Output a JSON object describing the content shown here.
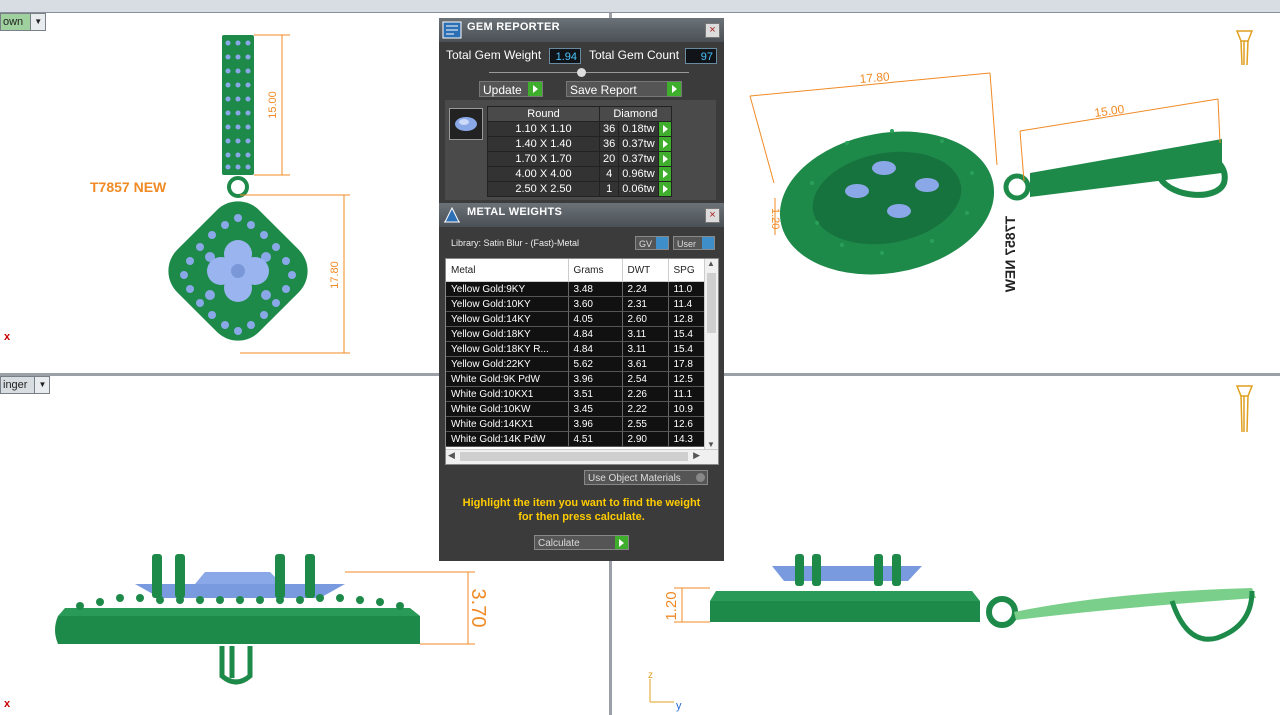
{
  "viewports": {
    "top_left_label": "own",
    "bottom_left_label": "inger"
  },
  "annotations": {
    "model_name": "T7857 NEW",
    "model_name_mirrored": "T7857 NEW",
    "dim_bail_length": "15.00",
    "dim_pendant_height": "17.80",
    "dim_side_height": "3.70",
    "dim_small_height": "1.20",
    "dim_persp_width": "17.80",
    "dim_persp_bail": "15.00",
    "dim_persp_small": "1.20",
    "axis_z": "z",
    "axis_y": "y",
    "red_mark": "x"
  },
  "gem_reporter": {
    "title": "GEM REPORTER",
    "total_weight_label": "Total Gem Weight",
    "total_weight_value": "1.94",
    "total_count_label": "Total Gem Count",
    "total_count_value": "97",
    "update_label": "Update",
    "save_label": "Save Report",
    "shape_header": "Round",
    "material_header": "Diamond",
    "rows": [
      {
        "size": "1.10 X 1.10",
        "count": "36",
        "weight": "0.18tw"
      },
      {
        "size": "1.40 X 1.40",
        "count": "36",
        "weight": "0.37tw"
      },
      {
        "size": "1.70 X 1.70",
        "count": "20",
        "weight": "0.37tw"
      },
      {
        "size": "4.00 X 4.00",
        "count": "4",
        "weight": "0.96tw"
      },
      {
        "size": "2.50 X 2.50",
        "count": "1",
        "weight": "0.06tw"
      }
    ]
  },
  "metal_weights": {
    "title": "METAL WEIGHTS",
    "library": "Library: Satin Blur - (Fast)-Metal",
    "toggle_gv": "GV",
    "toggle_user": "User",
    "columns": [
      "Metal",
      "Grams",
      "DWT",
      "SPG"
    ],
    "rows": [
      {
        "metal": "Yellow Gold:9KY",
        "grams": "3.48",
        "dwt": "2.24",
        "spg": "11.0"
      },
      {
        "metal": "Yellow Gold:10KY",
        "grams": "3.60",
        "dwt": "2.31",
        "spg": "11.4"
      },
      {
        "metal": "Yellow Gold:14KY",
        "grams": "4.05",
        "dwt": "2.60",
        "spg": "12.8"
      },
      {
        "metal": "Yellow Gold:18KY",
        "grams": "4.84",
        "dwt": "3.11",
        "spg": "15.4"
      },
      {
        "metal": "Yellow Gold:18KY R...",
        "grams": "4.84",
        "dwt": "3.11",
        "spg": "15.4"
      },
      {
        "metal": "Yellow Gold:22KY",
        "grams": "5.62",
        "dwt": "3.61",
        "spg": "17.8"
      },
      {
        "metal": "White Gold:9K PdW",
        "grams": "3.96",
        "dwt": "2.54",
        "spg": "12.5"
      },
      {
        "metal": "White Gold:10KX1",
        "grams": "3.51",
        "dwt": "2.26",
        "spg": "11.1"
      },
      {
        "metal": "White Gold:10KW",
        "grams": "3.45",
        "dwt": "2.22",
        "spg": "10.9"
      },
      {
        "metal": "White Gold:14KX1",
        "grams": "3.96",
        "dwt": "2.55",
        "spg": "12.6"
      },
      {
        "metal": "White Gold:14K PdW",
        "grams": "4.51",
        "dwt": "2.90",
        "spg": "14.3"
      }
    ],
    "use_object_materials": "Use Object Materials",
    "hint_line1": "Highlight the item you want to find the weight",
    "hint_line2": "for then press calculate.",
    "calculate_label": "Calculate"
  },
  "colors": {
    "metal_green": "#1e8a4a",
    "gem_blue": "#8aa8e8",
    "dimension_orange": "#f08a24",
    "panel_bg": "#3b3b3b",
    "accent_green": "#3fae2c",
    "hint_yellow": "#ffcc00"
  }
}
